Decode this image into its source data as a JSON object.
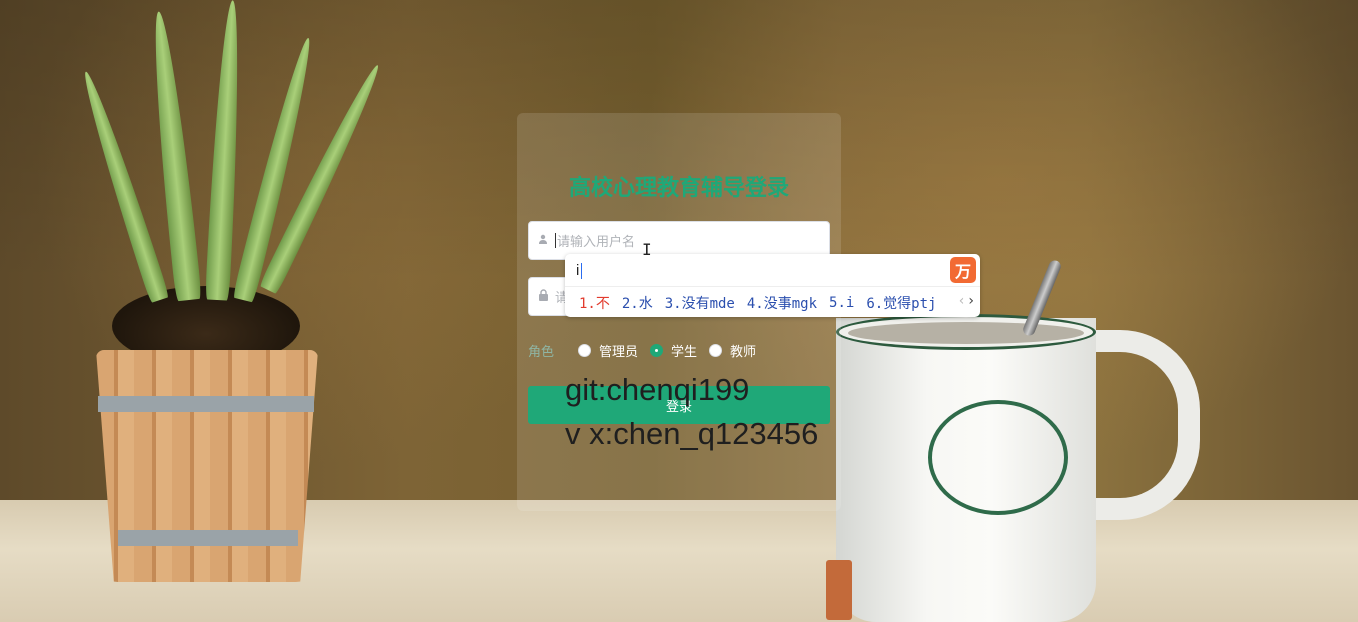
{
  "login": {
    "title": "高校心理教育辅导登录",
    "username_placeholder": "请输入用户名",
    "password_placeholder": "请",
    "role_label": "角色",
    "roles": [
      {
        "label": "管理员",
        "checked": false
      },
      {
        "label": "学生",
        "checked": true
      },
      {
        "label": "教师",
        "checked": false
      }
    ],
    "submit_label": "登录"
  },
  "overlay": {
    "line1": "git:chenqi199",
    "line2": "v x:chen_q123456"
  },
  "ime": {
    "composition": "i",
    "logo": "万",
    "candidates": [
      "1.不",
      "2.水",
      "3.没有mde",
      "4.没事mgk",
      "5.i",
      "6.觉得ptj"
    ],
    "prev_icon": "chevron-left-icon",
    "next_icon": "chevron-right-icon"
  },
  "icons": {
    "user": "user-icon",
    "lock": "lock-icon"
  },
  "colors": {
    "accent": "#1fa878",
    "ime_highlight": "#e23b2e",
    "ime_candidate": "#2b4fae"
  }
}
